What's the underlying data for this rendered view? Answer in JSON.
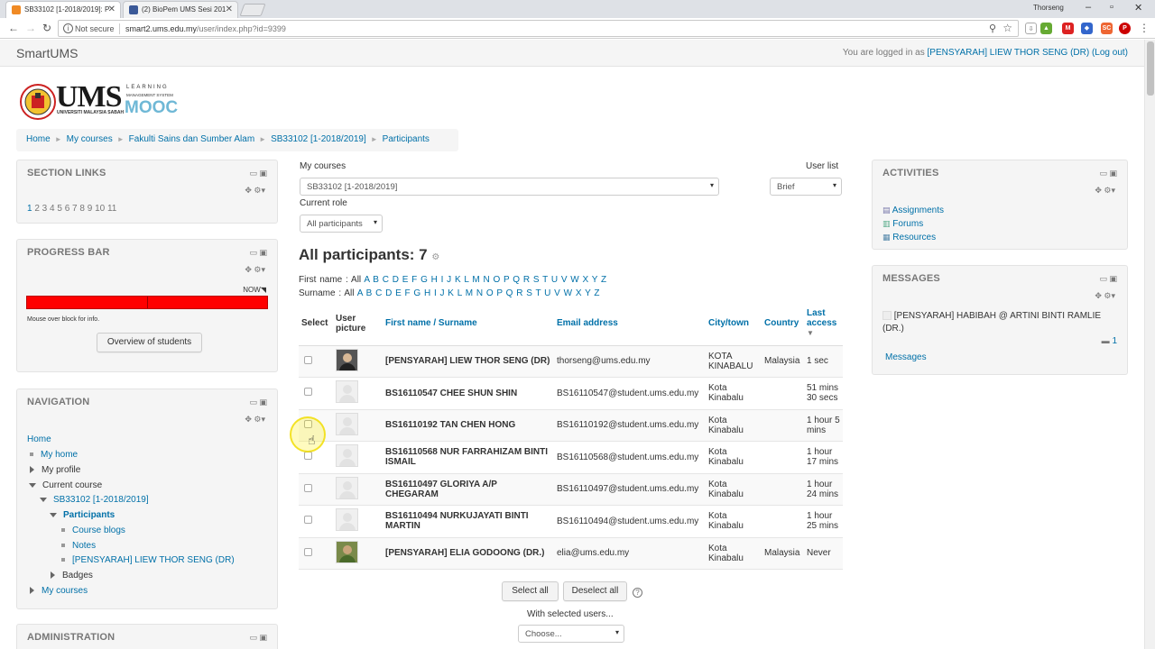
{
  "browser": {
    "tabs": [
      {
        "title": "SB33102 [1-2018/2019]: P",
        "favicon_color": "#f08a24"
      },
      {
        "title": "(2) BioPem UMS Sesi 201",
        "favicon_color": "#3b5998"
      }
    ],
    "os_user": "Thorseng",
    "security": "Not secure",
    "url_host": "smart2.ums.edu.my",
    "url_path": "/user/index.php?id=9399"
  },
  "site": {
    "brand": "SmartUMS",
    "login_prefix": "You are logged in as",
    "login_user": "[PENSYARAH] LIEW THOR SENG (DR)",
    "logout": "(Log out)"
  },
  "logo": {
    "ums": "UMS",
    "learning": "LEARNING",
    "lms": "MANAGEMENT SYSTEM",
    "univ": "UNIVERSITI MALAYSIA SABAH",
    "mooc": "MOOC"
  },
  "breadcrumb": [
    "Home",
    "My courses",
    "Fakulti Sains dan Sumber Alam",
    "SB33102 [1-2018/2019]",
    "Participants"
  ],
  "left": {
    "section_links": {
      "title": "SECTION LINKS",
      "first": "1",
      "rest": "2 3 4 5 6 7 8 9 10 11"
    },
    "progress": {
      "title": "PROGRESS BAR",
      "now": "NOW",
      "note": "Mouse over block for info.",
      "button": "Overview of students",
      "value": 1.0,
      "bar_color": "#ff0000"
    },
    "navigation": {
      "title": "NAVIGATION",
      "items": [
        "Home",
        "My home",
        "My profile",
        "Current course",
        "SB33102 [1-2018/2019]",
        "Participants",
        "Course blogs",
        "Notes",
        "[PENSYARAH] LIEW THOR SENG (DR)",
        "Badges",
        "My courses"
      ]
    },
    "administration": {
      "title": "ADMINISTRATION"
    }
  },
  "main": {
    "my_courses_label": "My courses",
    "course_select": "SB33102 [1-2018/2019]",
    "user_list_label": "User list",
    "user_list_select": "Brief",
    "role_label": "Current role",
    "role_select": "All participants",
    "heading": "All participants: 7",
    "firstname_label": "First name :",
    "surname_label": "Surname :",
    "all": "All",
    "letters": "A B C D E F G H I J K L M N O P Q R S T U V W X Y Z",
    "columns": [
      "Select",
      "User picture",
      "First name / Surname",
      "Email address",
      "City/town",
      "Country",
      "Last access"
    ],
    "rows": [
      {
        "name": "[PENSYARAH] LIEW THOR SENG (DR)",
        "email": "thorseng@ums.edu.my",
        "city": "KOTA KINABALU",
        "country": "Malaysia",
        "access": "1 sec",
        "photo": "person"
      },
      {
        "name": "BS16110547 CHEE SHUN SHIN",
        "email": "BS16110547@student.ums.edu.my",
        "city": "Kota Kinabalu",
        "country": "",
        "access": "51 mins 30 secs",
        "photo": "blank"
      },
      {
        "name": "BS16110192 TAN CHEN HONG",
        "email": "BS16110192@student.ums.edu.my",
        "city": "Kota Kinabalu",
        "country": "",
        "access": "1 hour 5 mins",
        "photo": "blank"
      },
      {
        "name": "BS16110568 NUR FARRAHIZAM BINTI ISMAIL",
        "email": "BS16110568@student.ums.edu.my",
        "city": "Kota Kinabalu",
        "country": "",
        "access": "1 hour 17 mins",
        "photo": "blank"
      },
      {
        "name": "BS16110497 GLORIYA A/P CHEGARAM",
        "email": "BS16110497@student.ums.edu.my",
        "city": "Kota Kinabalu",
        "country": "",
        "access": "1 hour 24 mins",
        "photo": "blank"
      },
      {
        "name": "BS16110494 NURKUJAYATI BINTI MARTIN",
        "email": "BS16110494@student.ums.edu.my",
        "city": "Kota Kinabalu",
        "country": "",
        "access": "1 hour 25 mins",
        "photo": "blank"
      },
      {
        "name": "[PENSYARAH] ELIA GODOONG (DR.)",
        "email": "elia@ums.edu.my",
        "city": "Kota Kinabalu",
        "country": "Malaysia",
        "access": "Never",
        "photo": "photo2"
      }
    ],
    "select_all": "Select all",
    "deselect_all": "Deselect all",
    "with_selected": "With selected users...",
    "choose": "Choose..."
  },
  "right": {
    "activities": {
      "title": "ACTIVITIES",
      "items": [
        "Assignments",
        "Forums",
        "Resources"
      ]
    },
    "messages": {
      "title": "MESSAGES",
      "sender": "[PENSYARAH] HABIBAH @ ARTINI BINTI RAMLIE (DR.)",
      "count": "1",
      "link": "Messages"
    }
  }
}
